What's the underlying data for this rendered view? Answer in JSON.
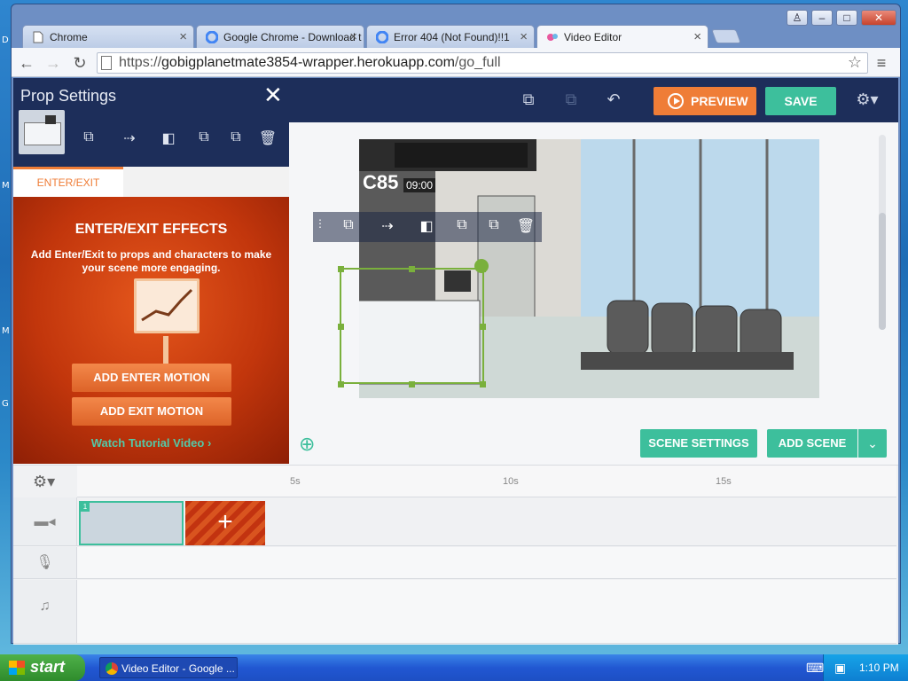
{
  "desktop": {
    "letters": [
      "D",
      "M",
      "M",
      "G"
    ]
  },
  "browser": {
    "tabs": [
      {
        "title": "Chrome",
        "icon": "document-icon"
      },
      {
        "title": "Google Chrome - Download t",
        "icon": "google-icon"
      },
      {
        "title": "Error 404 (Not Found)!!1",
        "icon": "google-icon"
      },
      {
        "title": "Video Editor",
        "icon": "app-icon"
      }
    ],
    "url_prefix": "https://",
    "url_host": "gobigplanetmate3854-wrapper.herokuapp.com",
    "url_path": "/go_full"
  },
  "app": {
    "preview_label": "PREVIEW",
    "save_label": "SAVE",
    "prop_panel": {
      "title": "Prop Settings",
      "tab_label": "ENTER/EXIT",
      "effects_title": "ENTER/EXIT EFFECTS",
      "effects_desc": "Add Enter/Exit to props and characters to make your scene more engaging.",
      "add_enter": "ADD ENTER MOTION",
      "add_exit": "ADD EXIT MOTION",
      "tutorial": "Watch Tutorial Video"
    },
    "scene": {
      "counter_sign": "C85",
      "clock": "09:00"
    },
    "scene_settings_label": "SCENE SETTINGS",
    "add_scene_label": "ADD SCENE",
    "timeline": {
      "ticks": [
        "5s",
        "10s",
        "15s"
      ],
      "scene_number": "1"
    }
  },
  "taskbar": {
    "start_label": "start",
    "task_title": "Video Editor - Google ...",
    "time": "1:10 PM"
  },
  "colors": {
    "accent_orange": "#ef7d37",
    "accent_green": "#3dbf9c",
    "app_header": "#1d2e5a"
  }
}
